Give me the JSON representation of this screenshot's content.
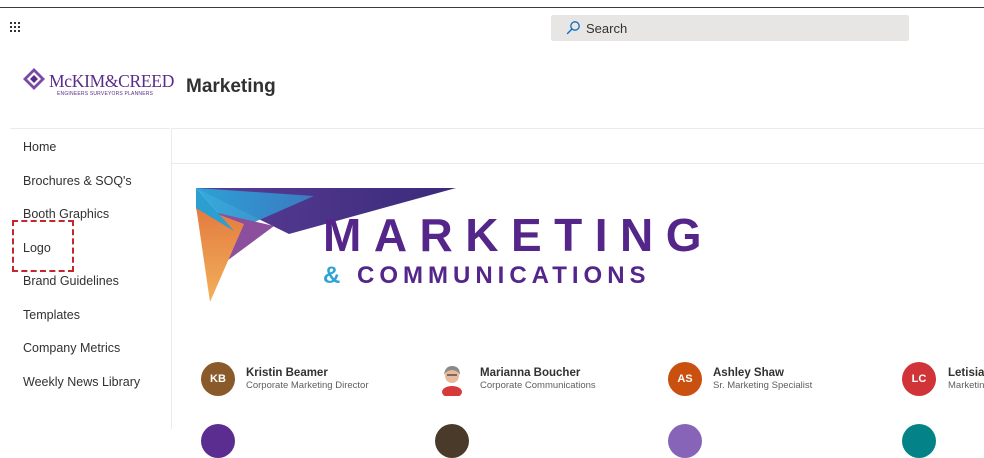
{
  "header": {
    "search_placeholder": "Search"
  },
  "site": {
    "logo_name": "McKIM&CREED",
    "logo_tagline": "ENGINEERS  SURVEYORS  PLANNERS",
    "title": "Marketing"
  },
  "nav": {
    "items": [
      {
        "label": "Home"
      },
      {
        "label": "Brochures & SOQ's"
      },
      {
        "label": "Booth Graphics"
      },
      {
        "label": "Logo"
      },
      {
        "label": "Brand Guidelines"
      },
      {
        "label": "Templates"
      },
      {
        "label": "Company Metrics"
      },
      {
        "label": "Weekly News Library"
      }
    ]
  },
  "banner": {
    "line1": "MARKETING",
    "line2_amp": "&",
    "line2_word": "COMMUNICATIONS"
  },
  "people": [
    {
      "initials": "KB",
      "name": "Kristin Beamer",
      "role": "Corporate Marketing Director",
      "color": "#8a5a2b"
    },
    {
      "initials": "",
      "name": "Marianna Boucher",
      "role": "Corporate Communications",
      "color": "#c0c0c0"
    },
    {
      "initials": "AS",
      "name": "Ashley Shaw",
      "role": "Sr. Marketing Specialist",
      "color": "#ca5010"
    },
    {
      "initials": "LC",
      "name": "Letisia C",
      "role": "Marketin",
      "color": "#d13438"
    }
  ],
  "colors": {
    "brand_purple": "#54268a",
    "accent_blue": "#2fa3d8",
    "focus_red": "#c4262e"
  }
}
